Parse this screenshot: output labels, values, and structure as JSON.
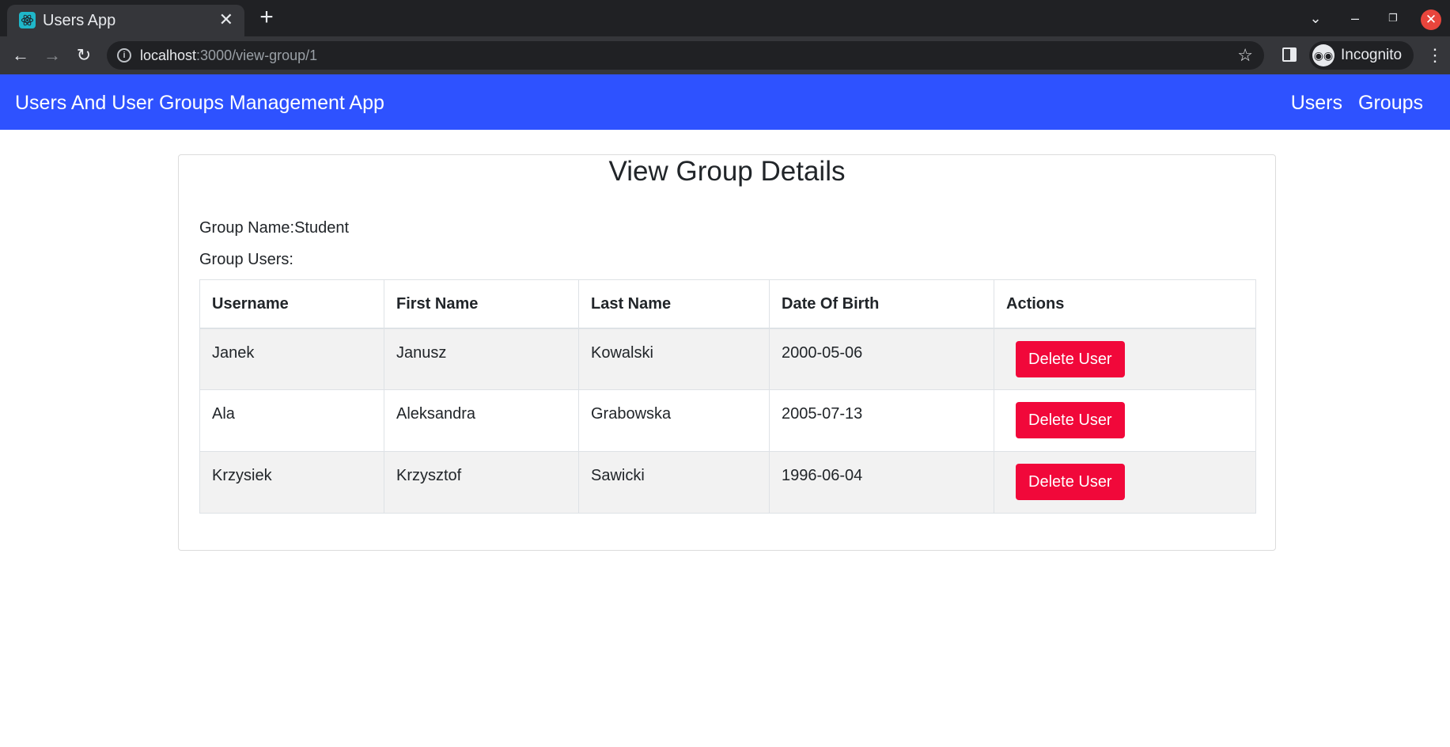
{
  "browser": {
    "tab_title": "Users App",
    "url_host": "localhost",
    "url_path": ":3000/view-group/1",
    "profile_label": "Incognito",
    "icons": {
      "favicon": "react-icon",
      "back": "back-arrow-icon",
      "forward": "forward-arrow-icon",
      "reload": "reload-icon",
      "site_info": "info-icon",
      "bookmark": "star-icon",
      "side_panel": "side-panel-icon",
      "menu": "kebab-menu-icon"
    }
  },
  "navbar": {
    "brand": "Users And User Groups Management App",
    "links": [
      "Users",
      "Groups"
    ],
    "background_color": "#2e52ff"
  },
  "page": {
    "title": "View Group Details",
    "group_name_label": "Group Name:",
    "group_name_value": "Student",
    "group_users_label": "Group Users:"
  },
  "table": {
    "columns": [
      "Username",
      "First Name",
      "Last Name",
      "Date Of Birth",
      "Actions"
    ],
    "rows": [
      {
        "username": "Janek",
        "first_name": "Janusz",
        "last_name": "Kowalski",
        "date_of_birth": "2000-05-06",
        "action_label": "Delete User"
      },
      {
        "username": "Ala",
        "first_name": "Aleksandra",
        "last_name": "Grabowska",
        "date_of_birth": "2005-07-13",
        "action_label": "Delete User"
      },
      {
        "username": "Krzysiek",
        "first_name": "Krzysztof",
        "last_name": "Sawicki",
        "date_of_birth": "1996-06-04",
        "action_label": "Delete User"
      }
    ],
    "delete_button_color": "#f1083a"
  }
}
